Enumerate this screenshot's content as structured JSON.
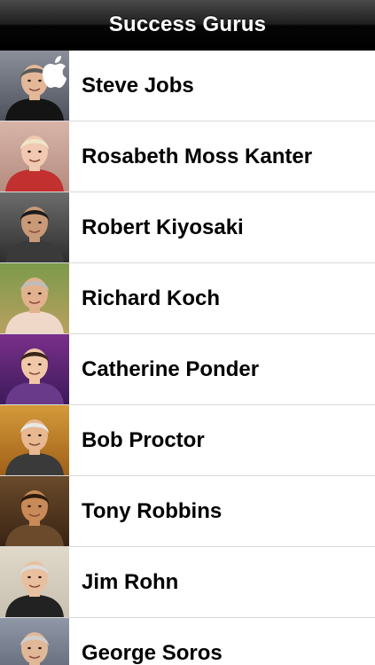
{
  "navbar": {
    "title": "Success Gurus"
  },
  "gurus": [
    {
      "name": "Steve Jobs",
      "bg_top": "#8a8f99",
      "bg_bottom": "#4d525c",
      "skin": "#e3b899",
      "hair": "#5a5a5a",
      "shirt": "#141414",
      "icon": "apple-logo"
    },
    {
      "name": "Rosabeth Moss Kanter",
      "bg_top": "#d8b4a8",
      "bg_bottom": "#b48c80",
      "skin": "#f0c9b0",
      "hair": "#efe6c8",
      "shirt": "#c23030"
    },
    {
      "name": "Robert Kiyosaki",
      "bg_top": "#6c6c6c",
      "bg_bottom": "#2e2e2e",
      "skin": "#c99a78",
      "hair": "#1a1a1a",
      "shirt": "#3a3a3a"
    },
    {
      "name": "Richard Koch",
      "bg_top": "#7c9a4a",
      "bg_bottom": "#b8a060",
      "skin": "#e2b28e",
      "hair": "#bdbdbd",
      "shirt": "#f0d8c8"
    },
    {
      "name": "Catherine Ponder",
      "bg_top": "#7a2f8a",
      "bg_bottom": "#3c1a5a",
      "skin": "#f0c8a8",
      "hair": "#3a2418",
      "shirt": "#6a3a8a"
    },
    {
      "name": "Bob Proctor",
      "bg_top": "#d49a3a",
      "bg_bottom": "#a06018",
      "skin": "#e8b890",
      "hair": "#e8e8e8",
      "shirt": "#3a3a3a"
    },
    {
      "name": "Tony Robbins",
      "bg_top": "#6a4a2a",
      "bg_bottom": "#3a2414",
      "skin": "#c88a58",
      "hair": "#2a1a0a",
      "shirt": "#6a4a2a"
    },
    {
      "name": "Jim Rohn",
      "bg_top": "#e0d8c8",
      "bg_bottom": "#c8c0b0",
      "skin": "#e8c0a0",
      "hair": "#dcdcdc",
      "shirt": "#222222"
    },
    {
      "name": "George Soros",
      "bg_top": "#9098a8",
      "bg_bottom": "#585e6c",
      "skin": "#e0b898",
      "hair": "#cfcfcf",
      "shirt": "#1e2230"
    }
  ]
}
